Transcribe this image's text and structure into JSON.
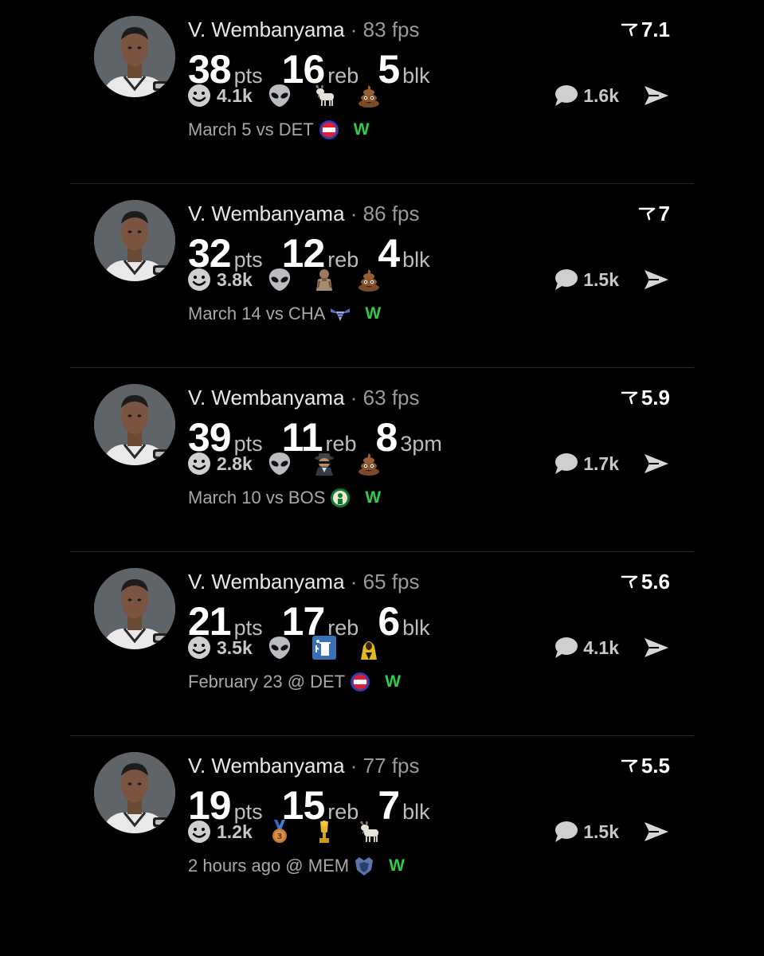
{
  "feed": {
    "posts": [
      {
        "player": "V. Wembanyama",
        "fps": "83 fps",
        "rating": "7.1",
        "stats": [
          {
            "value": "38",
            "unit": "pts"
          },
          {
            "value": "16",
            "unit": "reb"
          },
          {
            "value": "5",
            "unit": "blk"
          }
        ],
        "reaction_count": "4.1k",
        "emojis": [
          "alien-emoji",
          "goat-emoji",
          "poop-emoji"
        ],
        "comment_count": "1.6k",
        "game": "March 5 vs DET",
        "opponent_logo": "pistons-logo-icon",
        "result": "W"
      },
      {
        "player": "V. Wembanyama",
        "fps": "86 fps",
        "rating": "7",
        "stats": [
          {
            "value": "32",
            "unit": "pts"
          },
          {
            "value": "12",
            "unit": "reb"
          },
          {
            "value": "4",
            "unit": "blk"
          }
        ],
        "reaction_count": "3.8k",
        "emojis": [
          "alien-emoji",
          "beast-emoji",
          "poop-emoji"
        ],
        "comment_count": "1.5k",
        "game": "March 14 vs CHA",
        "opponent_logo": "hornets-logo-icon",
        "result": "W"
      },
      {
        "player": "V. Wembanyama",
        "fps": "63 fps",
        "rating": "5.9",
        "stats": [
          {
            "value": "39",
            "unit": "pts"
          },
          {
            "value": "11",
            "unit": "reb"
          },
          {
            "value": "8",
            "unit": "3pm"
          }
        ],
        "reaction_count": "2.8k",
        "emojis": [
          "alien-emoji",
          "spy-emoji",
          "poop-emoji"
        ],
        "comment_count": "1.7k",
        "game": "March 10 vs BOS",
        "opponent_logo": "celtics-logo-icon",
        "result": "W"
      },
      {
        "player": "V. Wembanyama",
        "fps": "65 fps",
        "rating": "5.6",
        "stats": [
          {
            "value": "21",
            "unit": "pts"
          },
          {
            "value": "17",
            "unit": "reb"
          },
          {
            "value": "6",
            "unit": "blk"
          }
        ],
        "reaction_count": "3.5k",
        "emojis": [
          "alien-emoji",
          "trash-can-emoji",
          "hooded-figure-emoji"
        ],
        "comment_count": "4.1k",
        "game": "February 23 @ DET",
        "opponent_logo": "pistons-logo-icon",
        "result": "W"
      },
      {
        "player": "V. Wembanyama",
        "fps": "77 fps",
        "rating": "5.5",
        "stats": [
          {
            "value": "19",
            "unit": "pts"
          },
          {
            "value": "15",
            "unit": "reb"
          },
          {
            "value": "7",
            "unit": "blk"
          }
        ],
        "reaction_count": "1.2k",
        "emojis": [
          "bronze-medal-emoji",
          "trophy-emoji",
          "goat-emoji"
        ],
        "comment_count": "1.5k",
        "game": "2 hours ago @ MEM",
        "opponent_logo": "grizzlies-logo-icon",
        "result": "W"
      }
    ]
  },
  "colors": {
    "background": "#000000",
    "result_win": "#2ecc4a",
    "muted_text": "#a8a8a8"
  }
}
